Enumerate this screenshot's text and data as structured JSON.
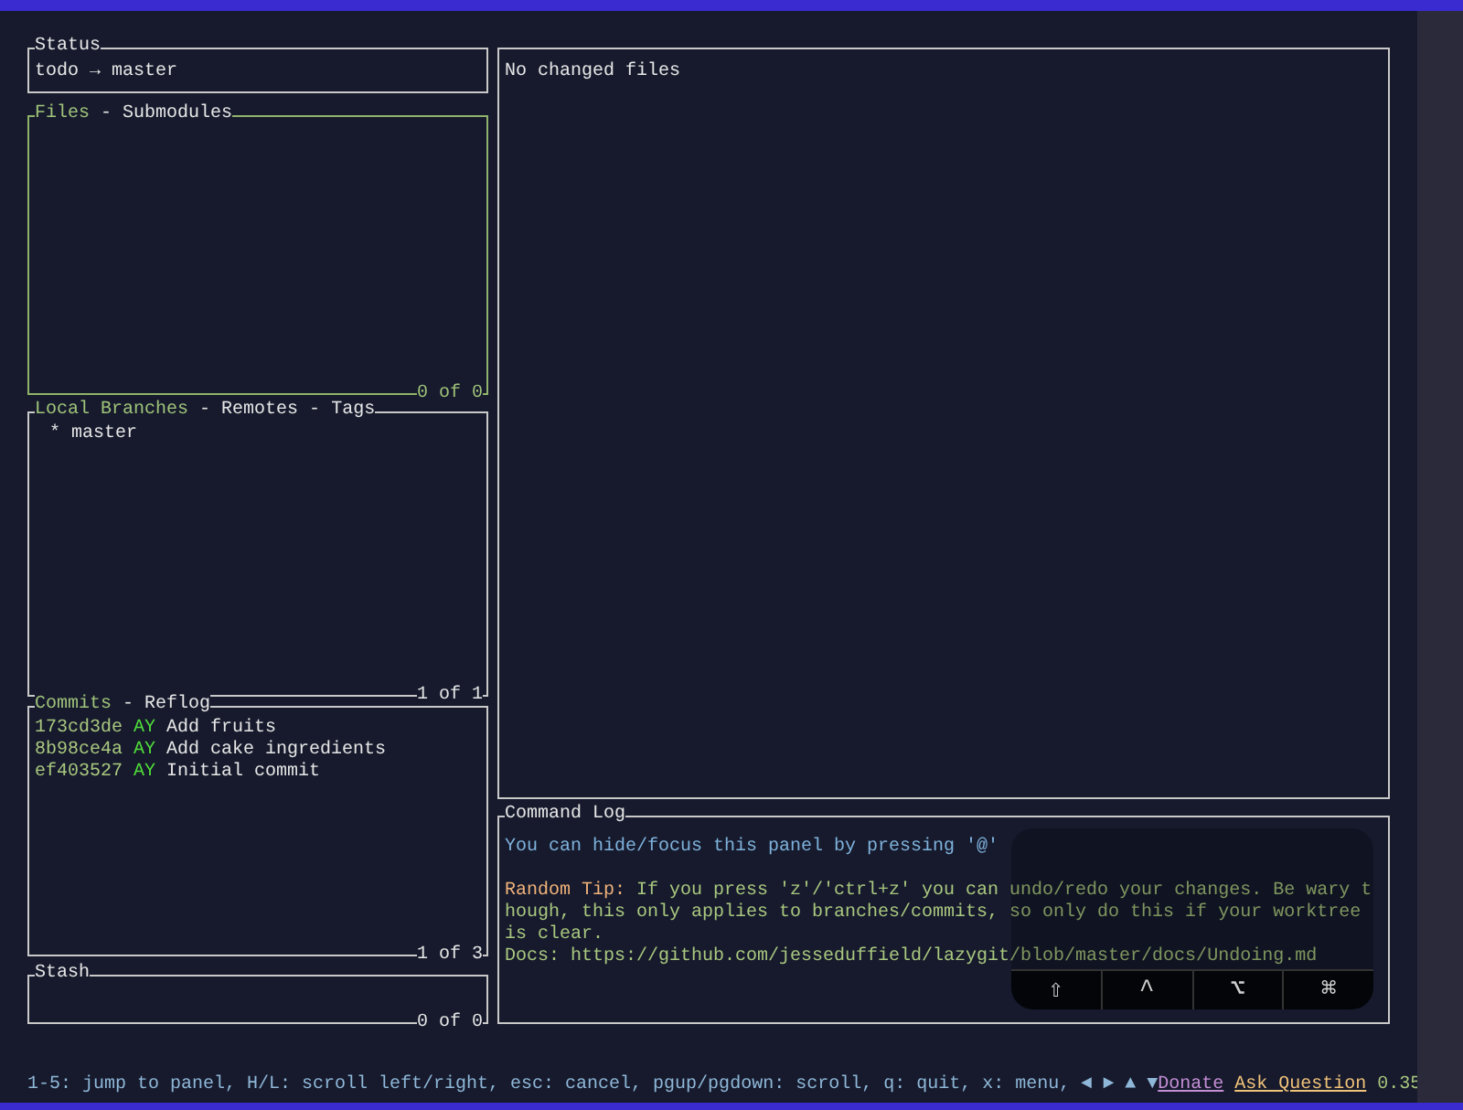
{
  "status": {
    "title": "Status",
    "text": "todo → master"
  },
  "panels": [
    {
      "kind": "files",
      "active": true,
      "separator": "-",
      "tabs": [
        {
          "label": "Files",
          "selected": true
        },
        {
          "label": "Submodules",
          "selected": false
        }
      ],
      "count": "0 of 0"
    },
    {
      "kind": "branches",
      "active": false,
      "separator": "-",
      "tabs": [
        {
          "label": "Local Branches",
          "selected": true
        },
        {
          "label": "Remotes",
          "selected": false
        },
        {
          "label": "Tags",
          "selected": false
        }
      ],
      "items": [
        "* master"
      ],
      "count": "1 of 1"
    },
    {
      "kind": "commits",
      "active": false,
      "separator": "-",
      "tabs": [
        {
          "label": "Commits",
          "selected": true
        },
        {
          "label": "Reflog",
          "selected": false
        }
      ],
      "commits": [
        {
          "hash": "173cd3de",
          "author": "AY",
          "message": "Add fruits"
        },
        {
          "hash": "8b98ce4a",
          "author": "AY",
          "message": "Add cake ingredients"
        },
        {
          "hash": "ef403527",
          "author": "AY",
          "message": "Initial commit"
        }
      ],
      "count": "1 of 3"
    },
    {
      "kind": "stash",
      "active": false,
      "tabs": [
        {
          "label": "Stash"
        }
      ],
      "count": "0 of 0"
    }
  ],
  "main": {
    "text": "No changed files"
  },
  "command_log": {
    "title": "Command Log",
    "lines": [
      {
        "kind": "info",
        "text": "You can hide/focus this panel by pressing '@'"
      },
      {
        "kind": "blank"
      },
      {
        "kind": "tip",
        "label": "Random Tip:",
        "text": " If you press 'z'/'ctrl+z' you can undo/redo your changes. Be wary though, this only applies to branches/commits, so only do this if your worktree is clear."
      },
      {
        "kind": "docs",
        "text": "Docs: https://github.com/jesseduffield/lazygit/blob/master/docs/Undoing.md"
      }
    ]
  },
  "keyboard_overlay": {
    "keys": [
      "⇧",
      "^",
      "⌥",
      "⌘"
    ]
  },
  "footer": {
    "keys": "1-5: jump to panel, H/L: scroll left/right, esc: cancel, pgup/pgdown: scroll, q: quit, x: menu, ◄ ► ▲ ▼",
    "links": [
      {
        "kind": "donate",
        "text": "Donate"
      },
      {
        "kind": "ask",
        "text": "Ask Question"
      }
    ],
    "version": "0.35"
  }
}
